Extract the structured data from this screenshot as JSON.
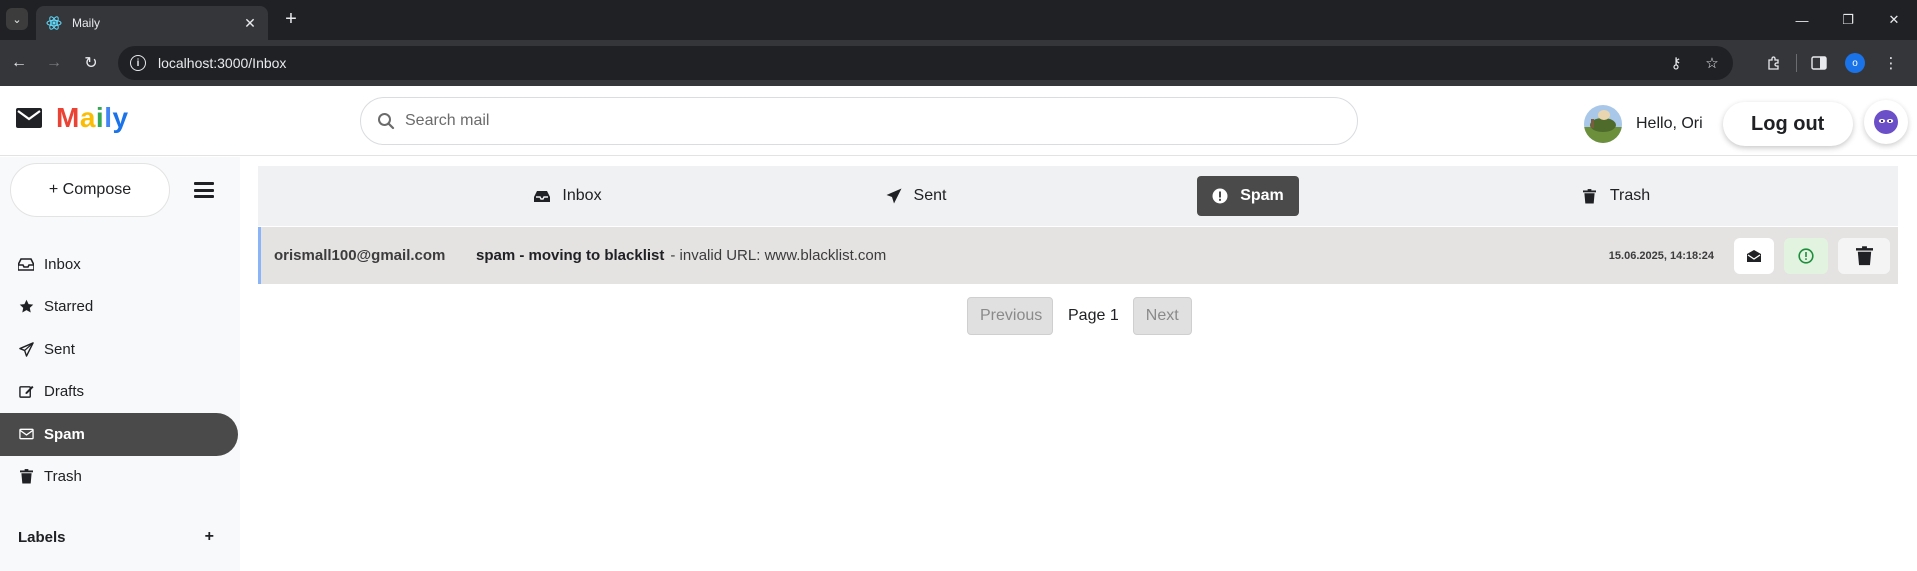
{
  "browser": {
    "tab_title": "Maily",
    "url": "localhost:3000/Inbox",
    "profile_initial": "o"
  },
  "header": {
    "brand": "Maily",
    "brand_colors": [
      "#ea4335",
      "#fbbc04",
      "#34a853",
      "#4285f4",
      "#1a73e8"
    ],
    "search_placeholder": "Search mail",
    "greeting": "Hello, Ori",
    "logout_label": "Log out"
  },
  "sidebar": {
    "compose_label": "+ Compose",
    "items": [
      {
        "label": "Inbox",
        "icon": "inbox-icon"
      },
      {
        "label": "Starred",
        "icon": "star-icon"
      },
      {
        "label": "Sent",
        "icon": "paper-plane-icon"
      },
      {
        "label": "Drafts",
        "icon": "edit-icon"
      },
      {
        "label": "Spam",
        "icon": "envelope-icon",
        "active": true
      },
      {
        "label": "Trash",
        "icon": "trash-icon"
      }
    ],
    "labels_title": "Labels",
    "labels_add": "+"
  },
  "folder_tabs": [
    {
      "label": "Inbox",
      "icon": "inbox-icon"
    },
    {
      "label": "Sent",
      "icon": "paper-plane-icon"
    },
    {
      "label": "Spam",
      "icon": "exclamation-circle-icon",
      "active": true
    },
    {
      "label": "Trash",
      "icon": "trash-icon"
    }
  ],
  "mails": [
    {
      "sender": "orismall100@gmail.com",
      "subject": "spam - moving to blacklist",
      "snippet": "- invalid URL: www.blacklist.com",
      "date": "15.06.2025, 14:18:24"
    }
  ],
  "pagination": {
    "previous": "Previous",
    "page": "Page 1",
    "next": "Next"
  },
  "colors": {
    "active_bg": "#4a4a4a",
    "row_bg": "#e5e2e2",
    "row_accent": "#8ab4f8",
    "not_spam_green": "#1e8e3e"
  }
}
